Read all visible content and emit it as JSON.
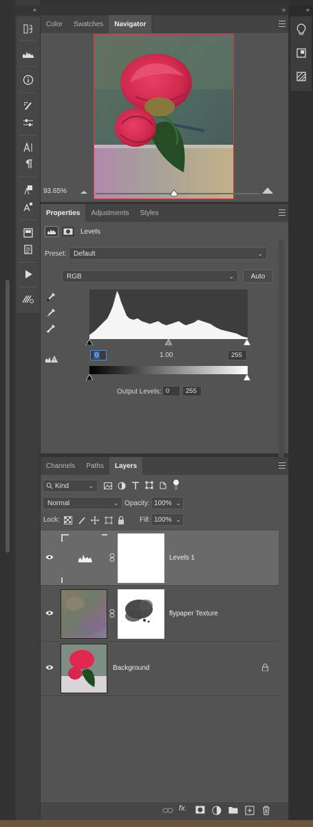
{
  "navigator_panel": {
    "tabs": [
      "Color",
      "Swatches",
      "Navigator"
    ],
    "active_tab": "Navigator",
    "zoom": "93.65%"
  },
  "properties_panel": {
    "tabs": [
      "Properties",
      "Adjustments",
      "Styles"
    ],
    "active_tab": "Properties",
    "adjustment_name": "Levels",
    "preset_label": "Preset:",
    "preset_value": "Default",
    "channel_value": "RGB",
    "auto_label": "Auto",
    "input_black": "0",
    "input_mid": "1.00",
    "input_white": "255",
    "output_label": "Output Levels:",
    "output_black": "0",
    "output_white": "255"
  },
  "layers_panel": {
    "tabs": [
      "Channels",
      "Paths",
      "Layers"
    ],
    "active_tab": "Layers",
    "filter_kind": "Kind",
    "blend_mode": "Normal",
    "opacity_label": "Opacity:",
    "opacity_value": "100%",
    "lock_label": "Lock:",
    "fill_label": "Fill:",
    "fill_value": "100%",
    "layers": [
      {
        "name": "Levels 1",
        "selected": true,
        "type": "adjustment"
      },
      {
        "name": "flypaper Texture",
        "selected": false,
        "type": "texture"
      },
      {
        "name": "Background",
        "selected": false,
        "type": "image",
        "locked": true
      }
    ]
  },
  "colors": {
    "panel_bg": "#535353",
    "tabbar_bg": "#424242",
    "selection_accent": "#4a90d9",
    "navigator_view_box": "#e03a3a"
  }
}
